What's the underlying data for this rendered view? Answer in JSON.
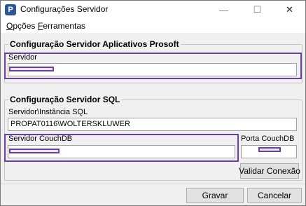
{
  "window": {
    "title": "Configurações Servidor",
    "app_icon_glyph": "P",
    "minimize_glyph": "—",
    "maximize_glyph": "☐",
    "close_glyph": "✕"
  },
  "menu": {
    "opcoes": {
      "first": "O",
      "rest": "pções"
    },
    "ferramentas": {
      "first": "F",
      "rest": "erramentas"
    }
  },
  "prosoft_group": {
    "title": "Configuração Servidor Aplicativos Prosoft",
    "servidor_label": "Servidor",
    "servidor_value": ""
  },
  "sql_group": {
    "title": "Configuração Servidor SQL",
    "instancia_label": "Servidor\\Instância SQL",
    "instancia_value": "PROPAT0116\\WOLTERSKLUWER",
    "couchdb_label": "Servidor CouchDB",
    "couchdb_value": "",
    "porta_label": "Porta CouchDB",
    "porta_value": "",
    "validar_button": "Validar Conexão"
  },
  "footer": {
    "gravar_button": "Gravar",
    "cancelar_button": "Cancelar"
  },
  "colors": {
    "highlight": "#6b3ea8",
    "window_bg": "#f0f0f0",
    "app_icon": "#2b5797"
  }
}
